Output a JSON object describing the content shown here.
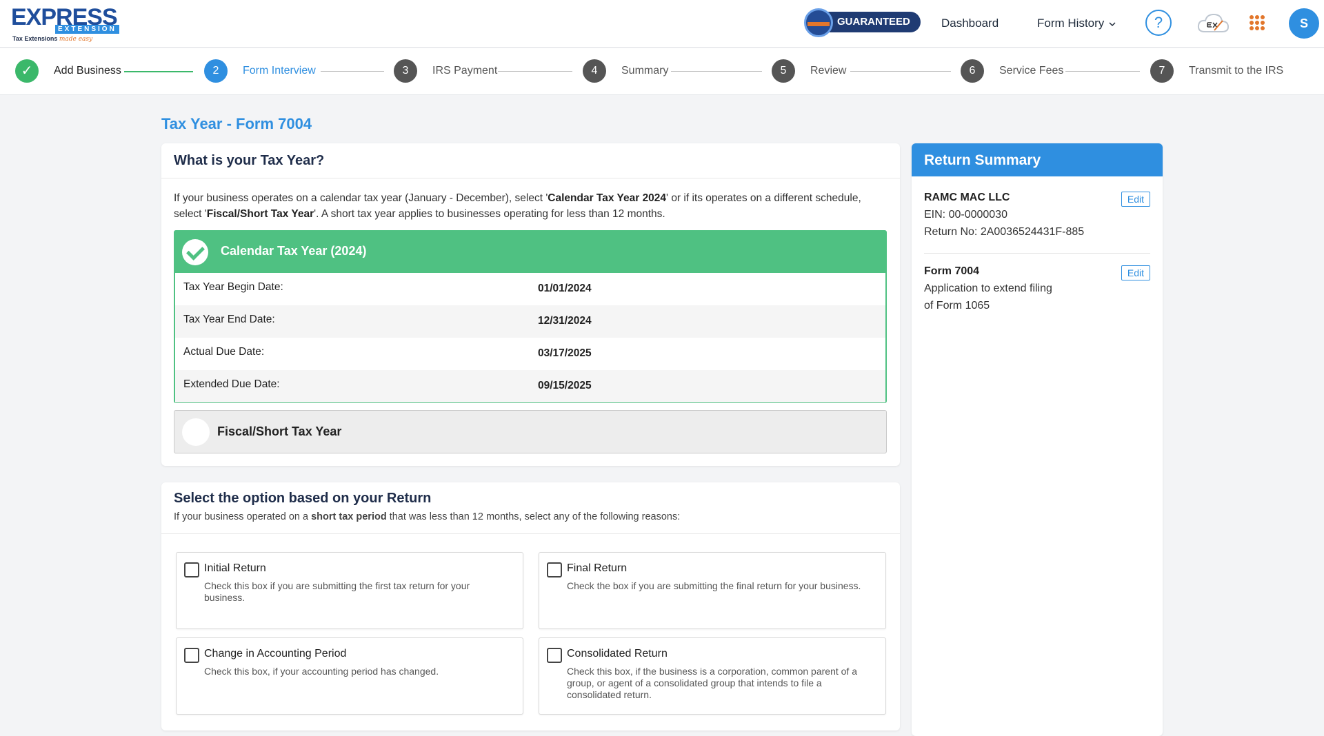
{
  "header": {
    "logo_main": "EXPRESS",
    "logo_sub": "EXTENSION",
    "logo_tagline": "Tax Extensions",
    "logo_tagline_script": "made easy",
    "guaranteed": "GUARANTEED",
    "nav": {
      "dashboard": "Dashboard",
      "form_history": "Form History"
    },
    "help_glyph": "?",
    "avatar_initial": "S"
  },
  "stepper": [
    {
      "num": "✓",
      "label": "Add Business",
      "state": "done"
    },
    {
      "num": "2",
      "label": "Form Interview",
      "state": "active"
    },
    {
      "num": "3",
      "label": "IRS Payment",
      "state": "todo"
    },
    {
      "num": "4",
      "label": "Summary",
      "state": "todo"
    },
    {
      "num": "5",
      "label": "Review",
      "state": "todo"
    },
    {
      "num": "6",
      "label": "Service Fees",
      "state": "todo"
    },
    {
      "num": "7",
      "label": "Transmit to the IRS",
      "state": "todo"
    }
  ],
  "page_title": "Tax Year - Form 7004",
  "tax_year": {
    "title": "What is your Tax Year?",
    "desc_1": "If your business operates on a calendar tax year (January - December), select '",
    "desc_b1": "Calendar Tax Year 2024",
    "desc_2": "' or if its operates on a different schedule, select '",
    "desc_b2": "Fiscal/Short Tax Year",
    "desc_3": "'. A short tax year applies to businesses operating for less than 12 months.",
    "calendar_option": "Calendar Tax Year (2024)",
    "dates": [
      {
        "label": "Tax Year Begin Date:",
        "value": "01/01/2024"
      },
      {
        "label": "Tax Year End Date:",
        "value": "12/31/2024"
      },
      {
        "label": "Actual Due Date:",
        "value": "03/17/2025"
      },
      {
        "label": "Extended Due Date:",
        "value": "09/15/2025"
      }
    ],
    "fiscal_option": "Fiscal/Short Tax Year"
  },
  "return_option": {
    "title": "Select the option based on your Return",
    "sub_1": "If your business operated on a ",
    "sub_b": "short tax period",
    "sub_2": " that was less than 12 months, select any of the following reasons:",
    "options": [
      {
        "title": "Initial Return",
        "desc": "Check this box if you are submitting the first tax return for your business."
      },
      {
        "title": "Final Return",
        "desc": "Check the box if you are submitting the final return for your business."
      },
      {
        "title": "Change in Accounting Period",
        "desc": "Check this box, if your accounting period has changed."
      },
      {
        "title": "Consolidated Return",
        "desc": "Check this box, if the business is a corporation, common parent of a group, or agent of a consolidated group that intends to file a consolidated return."
      }
    ]
  },
  "summary": {
    "title": "Return Summary",
    "business_name": "RAMC MAC LLC",
    "ein": "EIN: 00-0000030",
    "return_no": "Return No: 2A0036524431F-885",
    "form_name": "Form 7004",
    "form_desc_1": "Application to extend filing",
    "form_desc_2": "of Form 1065",
    "edit_label": "Edit"
  },
  "colors": {
    "brand_blue": "#2f8fe0",
    "navy": "#1f2d4a",
    "success_green": "#4fc182",
    "accent_orange": "#e2762b"
  }
}
